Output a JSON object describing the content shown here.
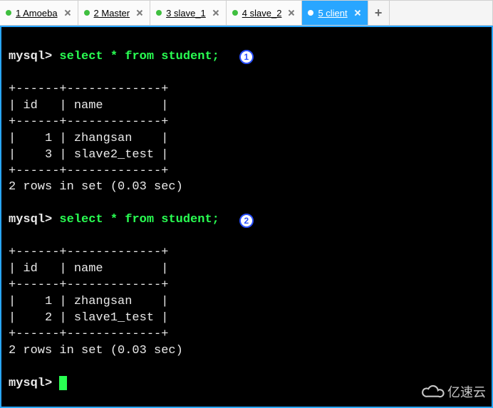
{
  "tabs": [
    {
      "label": "1 Amoeba"
    },
    {
      "label": "2 Master"
    },
    {
      "label": "3 slave_1"
    },
    {
      "label": "4 slave_2"
    },
    {
      "label": "5 client",
      "active": true
    }
  ],
  "newtab_glyph": "+",
  "terminal": {
    "prompt": "mysql> ",
    "blocks": [
      {
        "annotation": "1",
        "command": "select * from student;",
        "table_lines": [
          "+------+-------------+",
          "| id   | name        |",
          "+------+-------------+",
          "|    1 | zhangsan    |",
          "|    3 | slave2_test |",
          "+------+-------------+"
        ],
        "status": "2 rows in set (0.03 sec)"
      },
      {
        "annotation": "2",
        "command": "select * from student;",
        "table_lines": [
          "+------+-------------+",
          "| id   | name        |",
          "+------+-------------+",
          "|    1 | zhangsan    |",
          "|    2 | slave1_test |",
          "+------+-------------+"
        ],
        "status": "2 rows in set (0.03 sec)"
      }
    ]
  },
  "watermark_text": "亿速云"
}
